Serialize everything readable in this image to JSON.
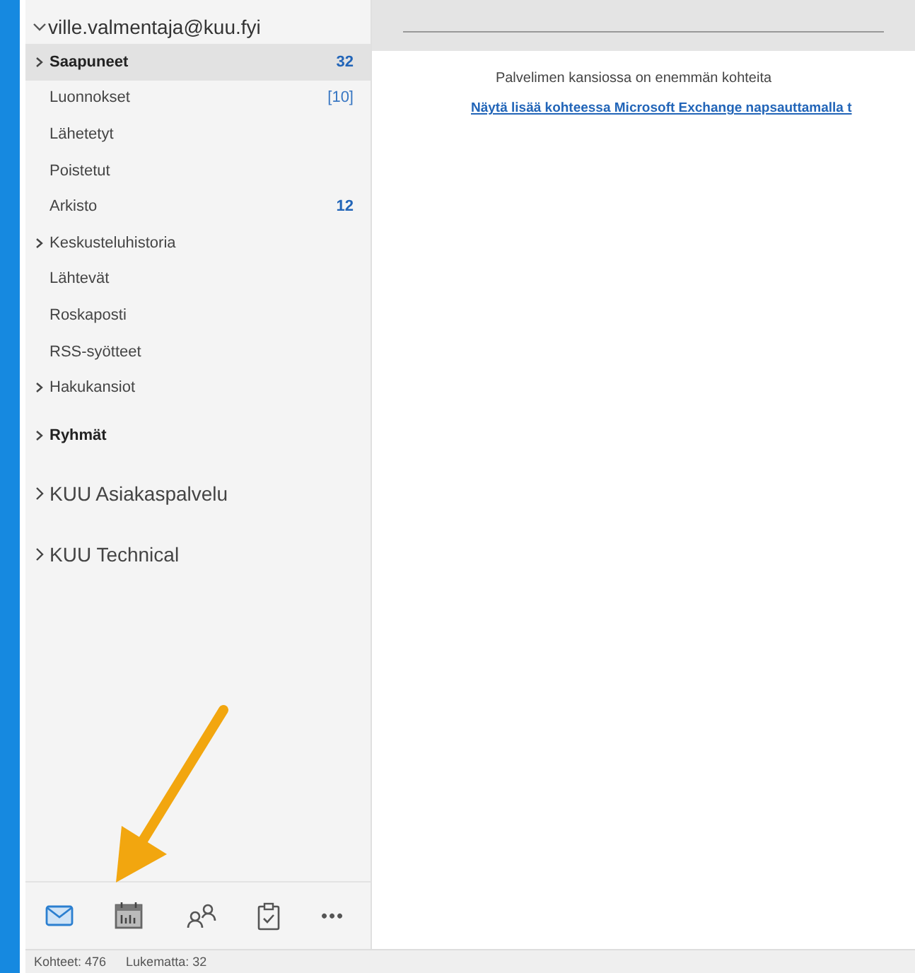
{
  "account": {
    "name": "ville.valmentaja@kuu.fyi",
    "expanded": true
  },
  "folders": [
    {
      "label": "Saapuneet",
      "count": "32",
      "kind": "parent",
      "selected": true
    },
    {
      "label": "Luonnokset",
      "count": "[10]",
      "kind": "leaf",
      "selected": false
    },
    {
      "label": "Lähetetyt",
      "kind": "leaf",
      "selected": false
    },
    {
      "label": "Poistetut",
      "kind": "leaf",
      "selected": false
    },
    {
      "label": "Arkisto",
      "count": "12",
      "kind": "leaf",
      "selected": false
    },
    {
      "label": "Keskusteluhistoria",
      "kind": "parent",
      "selected": false
    },
    {
      "label": "Lähtevät",
      "kind": "leaf",
      "selected": false
    },
    {
      "label": "Roskaposti",
      "kind": "leaf",
      "selected": false
    },
    {
      "label": "RSS-syötteet",
      "kind": "leaf",
      "selected": false
    },
    {
      "label": "Hakukansiot",
      "kind": "parent",
      "selected": false
    }
  ],
  "groups": {
    "label": "Ryhmät",
    "expanded": false
  },
  "other_accounts": [
    {
      "name": "KUU Asiakaspalvelu",
      "expanded": false
    },
    {
      "name": "KUU Technical",
      "expanded": false
    }
  ],
  "notice": {
    "text": "Palvelimen kansiossa on enemmän kohteita",
    "link": "Näytä lisää kohteessa Microsoft Exchange napsauttamalla t"
  },
  "nav": [
    {
      "kind": "mail",
      "selected": true
    },
    {
      "kind": "calendar",
      "selected": false
    },
    {
      "kind": "people",
      "selected": false
    },
    {
      "kind": "tasks",
      "selected": false
    },
    {
      "kind": "more",
      "label": "•••",
      "selected": false
    }
  ],
  "status_bar": [
    "Kohteet: 476",
    "Lukematta: 32"
  ]
}
